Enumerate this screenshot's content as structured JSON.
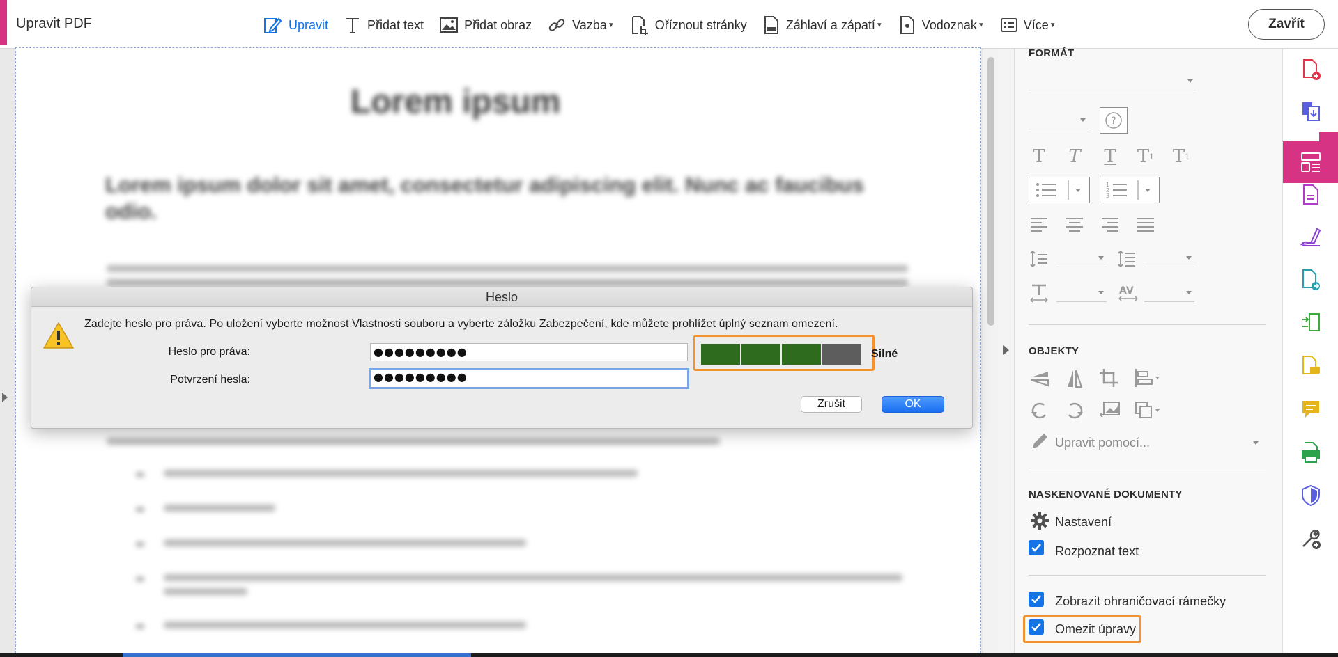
{
  "app": {
    "title": "Upravit PDF",
    "close_label": "Zavřít"
  },
  "toolbar": {
    "items": [
      {
        "label": "Upravit",
        "icon": "edit-icon",
        "active": true,
        "dropdown": false
      },
      {
        "label": "Přidat text",
        "icon": "text-icon",
        "active": false,
        "dropdown": false
      },
      {
        "label": "Přidat obraz",
        "icon": "image-icon",
        "active": false,
        "dropdown": false
      },
      {
        "label": "Vazba",
        "icon": "link-icon",
        "active": false,
        "dropdown": true
      },
      {
        "label": "Oříznout stránky",
        "icon": "crop-pages-icon",
        "active": false,
        "dropdown": false
      },
      {
        "label": "Záhlaví a zápatí",
        "icon": "header-footer-icon",
        "active": false,
        "dropdown": true
      },
      {
        "label": "Vodoznak",
        "icon": "watermark-icon",
        "active": false,
        "dropdown": true
      },
      {
        "label": "Více",
        "icon": "more-icon",
        "active": false,
        "dropdown": true
      }
    ]
  },
  "document": {
    "heading": "Lorem ipsum",
    "subheading": "Lorem ipsum dolor sit amet, consectetur adipiscing elit. Nunc ac faucibus odio."
  },
  "dialog": {
    "title": "Heslo",
    "message": "Zadejte heslo pro práva. Po uložení vyberte možnost Vlastnosti souboru a vyberte záložku Zabezpečení, kde můžete prohlížet úplný seznam omezení.",
    "password_label": "Heslo pro práva:",
    "password_value": "●●●●●●●●●",
    "confirm_label": "Potvrzení hesla:",
    "confirm_value": "●●●●●●●●●",
    "strength_label": "Silné",
    "strength_level": 0.75,
    "strength_colors": [
      "#2e6b1e",
      "#2e6b1e",
      "#2e6b1e",
      "#5d5d5d"
    ],
    "cancel_label": "Zrušit",
    "ok_label": "OK"
  },
  "panel": {
    "format": {
      "heading": "FORMÁT"
    },
    "objects": {
      "heading": "OBJEKTY",
      "edit_with_label": "Upravit pomocí..."
    },
    "scanned": {
      "heading": "NASKENOVANÉ DOKUMENTY",
      "settings_label": "Nastavení",
      "recognize_label": "Rozpoznat text",
      "recognize_checked": true
    },
    "show_boxes_label": "Zobrazit ohraničovací rámečky",
    "show_boxes_checked": true,
    "restrict_label": "Omezit úpravy",
    "restrict_checked": true
  },
  "rail": {
    "icons": [
      "create-pdf-icon",
      "combine-files-icon",
      "edit-pdf-icon",
      "export-pdf-icon",
      "fill-sign-icon",
      "send-for-review-icon",
      "organize-pages-icon",
      "comment-icon",
      "stamp-icon",
      "print-production-icon",
      "protect-icon",
      "more-tools-icon"
    ]
  },
  "colors": {
    "accent": "#1473e6",
    "brand": "#d63384",
    "highlight": "#f2932f"
  }
}
